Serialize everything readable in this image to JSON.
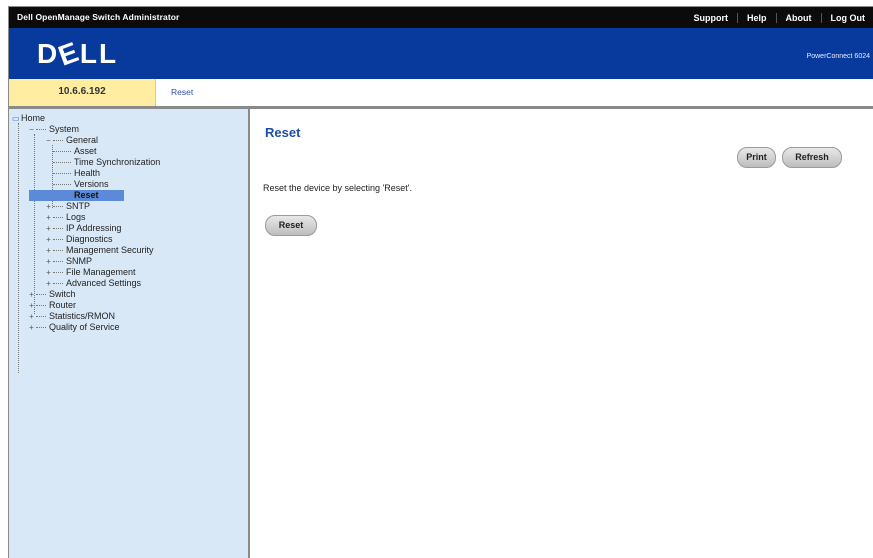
{
  "app_title": "Dell OpenManage Switch Administrator",
  "top_links": [
    "Support",
    "Help",
    "About",
    "Log Out"
  ],
  "logo": "DELL",
  "product_name": "PowerConnect 6024",
  "address": "10.6.6.192",
  "breadcrumb": "Reset",
  "tree": {
    "home": "Home",
    "system": "System",
    "general": "General",
    "general_children": [
      "Asset",
      "Time Synchronization",
      "Health",
      "Versions",
      "Reset"
    ],
    "system_children": [
      "SNTP",
      "Logs",
      "IP Addressing",
      "Diagnostics",
      "Management Security",
      "SNMP",
      "File Management",
      "Advanced Settings"
    ],
    "top_level": [
      "Switch",
      "Router",
      "Statistics/RMON",
      "Quality of Service"
    ],
    "selected": "Reset"
  },
  "main": {
    "title": "Reset",
    "print_label": "Print",
    "refresh_label": "Refresh",
    "description": "Reset the device by selecting 'Reset'.",
    "reset_label": "Reset"
  }
}
